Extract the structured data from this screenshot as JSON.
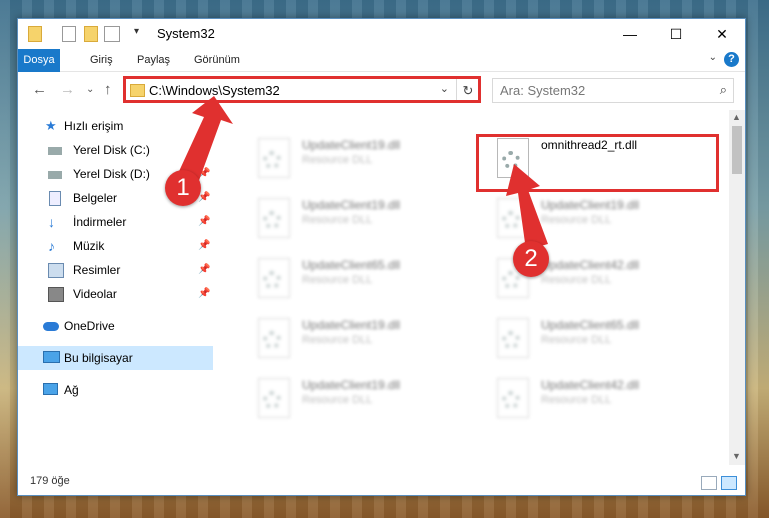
{
  "window": {
    "title": "System32",
    "minimize": "—",
    "maximize": "☐",
    "close": "✕"
  },
  "ribbon": {
    "tabs": [
      "Dosya",
      "Giriş",
      "Paylaş",
      "Görünüm"
    ],
    "help": "?",
    "expand": "⌄"
  },
  "navigation": {
    "back": "←",
    "forward": "→",
    "recent": "⌄",
    "up": "↑"
  },
  "address": {
    "path": "C:\\Windows\\System32",
    "dropdown": "⌄",
    "refresh": "↻"
  },
  "search": {
    "placeholder": "Ara: System32",
    "icon": "⌕"
  },
  "sidebar": {
    "items": [
      {
        "label": "Hızlı erişim",
        "icon": "star-icon",
        "pinned": false
      },
      {
        "label": "Yerel Disk (C:)",
        "icon": "drive-icon",
        "pinned": true
      },
      {
        "label": "Yerel Disk (D:)",
        "icon": "drive-icon",
        "pinned": true
      },
      {
        "label": "Belgeler",
        "icon": "documents-icon",
        "pinned": true
      },
      {
        "label": "İndirmeler",
        "icon": "download-icon",
        "pinned": true
      },
      {
        "label": "Müzik",
        "icon": "music-icon",
        "pinned": true
      },
      {
        "label": "Resimler",
        "icon": "pictures-icon",
        "pinned": true
      },
      {
        "label": "Videolar",
        "icon": "videos-icon",
        "pinned": true
      },
      {
        "label": "OneDrive",
        "icon": "cloud-icon",
        "pinned": false
      },
      {
        "label": "Bu bilgisayar",
        "icon": "computer-icon",
        "pinned": false
      },
      {
        "label": "Ağ",
        "icon": "network-icon",
        "pinned": false
      }
    ],
    "pin_glyph": "📌"
  },
  "files": [
    {
      "name": "UpdateClient19.dll",
      "type": "Resource DLL"
    },
    {
      "name": "omnithread2_rt.dll",
      "type": ""
    },
    {
      "name": "UpdateClient19.dll",
      "type": "Resource DLL"
    },
    {
      "name": "UpdateClient19.dll",
      "type": "Resource DLL"
    },
    {
      "name": "UpdateClient65.dll",
      "type": "Resource DLL"
    },
    {
      "name": "UpdateClient42.dll",
      "type": "Resource DLL"
    },
    {
      "name": "UpdateClient19.dll",
      "type": "Resource DLL"
    },
    {
      "name": "UpdateClient65.dll",
      "type": "Resource DLL"
    },
    {
      "name": "UpdateClient19.dll",
      "type": "Resource DLL"
    },
    {
      "name": "UpdateClient42.dll",
      "type": "Resource DLL"
    }
  ],
  "status": {
    "item_count": "179 öğe"
  },
  "callouts": [
    "1",
    "2"
  ],
  "colors": {
    "accent": "#1979ca",
    "highlight": "#e0302f",
    "selection": "#cce8ff"
  }
}
